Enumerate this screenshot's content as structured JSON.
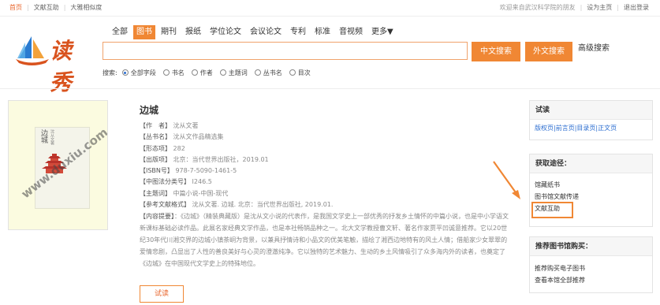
{
  "topbar": {
    "home": "首页",
    "doc_help": "文献互助",
    "big_data": "大雅相似度",
    "welcome": "欢迎来自武汉科学院的朋友",
    "set_home": "设为主页",
    "logout": "退出登录"
  },
  "logo": {
    "text": "读秀"
  },
  "tabs": [
    "全部",
    "图书",
    "期刊",
    "报纸",
    "学位论文",
    "会议论文",
    "专利",
    "标准",
    "音视频",
    "更多▼"
  ],
  "search": {
    "value": "",
    "cn_button": "中文搜索",
    "en_button": "外文搜索",
    "advanced": "高级搜索",
    "fields_label": "搜索:",
    "fields": [
      "全部字段",
      "书名",
      "作者",
      "主题词",
      "丛书名",
      "目次"
    ],
    "selected_field": "全部字段"
  },
  "cover": {
    "title": "边城",
    "author": "沈从文著",
    "watermark": "www.duxiu.com"
  },
  "book": {
    "title": "边城",
    "rows": [
      {
        "k": "【作　者】",
        "v": "沈从文著"
      },
      {
        "k": "【丛书名】",
        "v": "沈从文作品精选集"
      },
      {
        "k": "【形态项】",
        "v": "282"
      },
      {
        "k": "【出版项】",
        "v": "北京：当代世界出版社，2019.01"
      },
      {
        "k": "【ISBN号】",
        "v": "978-7-5090-1461-5"
      },
      {
        "k": "【中图法分类号】",
        "v": "I246.5"
      },
      {
        "k": "【主题词】",
        "v": "中篇小说-中国-现代"
      },
      {
        "k": "【参考文献格式】",
        "v": "沈从文著. 边城. 北京：当代世界出版社, 2019.01."
      }
    ],
    "abstract_key": "【内容提要】",
    "abstract": "：《边城》（精装典藏版）是沈从文小说的代表作，是我国文学史上一部优秀的抒发乡土情怀的中篇小说，也是中小学语文新课标基础必读作品。此展名家经典文学作品，也是本社畅销品种之一。北大文学教授曹文轩、著名作家贾平凹诚意推荐。它以20世纪30年代川湘交界的边城小镇茶峒为背景，以兼具抒情诗和小品文的优美笔触，描绘了湘西边地特有的风土人情；借船家少女翠翠的爱情悲剧，凸显出了人性的善良美好与心灵的澄澈纯净。它以独特的艺术魅力、生动的乡土风情吸引了众多海内外的读者，也奠定了《边城》在中国现代文学史上的特殊地位。",
    "read_button": "试读"
  },
  "panels": {
    "read": {
      "title": "试读",
      "links": "版权页|前言页|目录页|正文页"
    },
    "access": {
      "title": "获取途径：",
      "items": [
        "馆藏纸书",
        "图书馆文献传递",
        "文献互助"
      ]
    },
    "recommend": {
      "title": "推荐图书馆购买：",
      "items": [
        "推荐购买电子图书",
        "查看本馆全部推荐"
      ]
    }
  },
  "colors": {
    "accent": "#f08734",
    "link": "#2b6dd0",
    "logo": "#d9531e"
  }
}
